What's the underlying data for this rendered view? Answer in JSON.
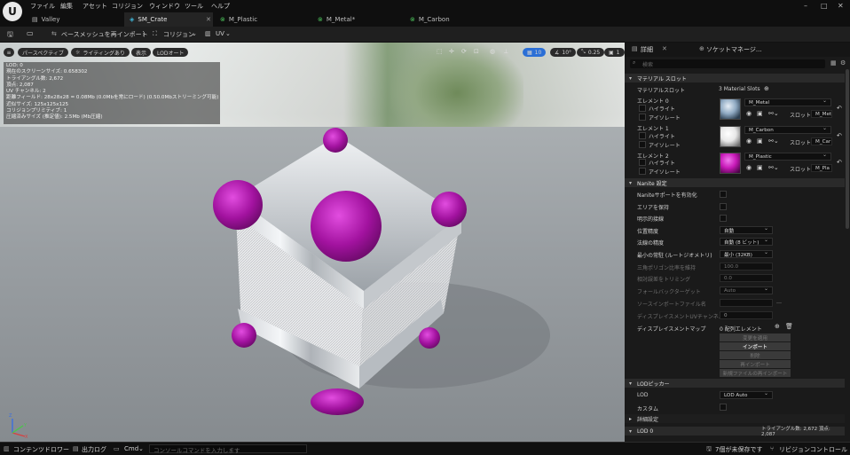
{
  "app": {
    "logo": "U"
  },
  "menu": [
    "ファイル",
    "編集",
    "アセット",
    "コリジョン",
    "ウィンドウ",
    "ツール",
    "ヘルプ"
  ],
  "tabs": [
    {
      "label": "Valley",
      "icon": "level-icon",
      "active": false
    },
    {
      "label": "SM_Crate",
      "icon": "static-mesh-icon",
      "active": true
    },
    {
      "label": "M_Plastic",
      "icon": "material-icon",
      "active": false
    },
    {
      "label": "M_Metal*",
      "icon": "material-icon",
      "active": false
    },
    {
      "label": "M_Carbon",
      "icon": "material-icon",
      "active": false
    }
  ],
  "window_controls": [
    "–",
    "□",
    "✕"
  ],
  "toolbar": {
    "save_icon": "save-icon",
    "browse_icon": "browse-icon",
    "reimport_label": "ベースメッシュを再インポート",
    "collision_label": "コリジョン",
    "uv_label": "UV"
  },
  "viewport": {
    "menu_icon": "≡",
    "perspective": "パースペクティブ",
    "lighting": "ライティングあり",
    "show": "表示",
    "lod": "LODオート",
    "grid_snap": "10",
    "rot_snap": "10°",
    "scale_snap": "0.25",
    "cam_speed": "1",
    "stats": [
      "LOD: 0",
      "現在のスクリーンサイズ: 0.658302",
      "トライアングル数: 2,672",
      "頂点: 2,087",
      "UV チャンネル: 2",
      "距離フィールド: 28x28x28 = 0.08Mb (0.0Mbを常にロード) (0.50.0Mbストリーミング可能)",
      "近似サイズ: 125x125x125",
      "コリジョンプリミティブ: 1",
      "圧縮済みサイズ (推定値): 2.5Mb (Mb圧縮)"
    ],
    "axis": {
      "x": "X",
      "y": "Y",
      "z": "Z"
    }
  },
  "panel": {
    "tabs": [
      "詳細",
      "ソケットマネージ..."
    ],
    "search_placeholder": "検索",
    "material_section": "マテリアル スロット",
    "material_slots_label": "マテリアルスロット",
    "material_slots_value": "3 Material Slots",
    "elements": [
      {
        "label": "エレメント 0",
        "highlight": "ハイライト",
        "isolate": "アイソレート",
        "material": "M_Metal",
        "slot": "スロット名",
        "slot_value": "M_Met",
        "color": "#8fa9c2"
      },
      {
        "label": "エレメント 1",
        "highlight": "ハイライト",
        "isolate": "アイソレート",
        "material": "M_Carbon",
        "slot": "スロット名",
        "slot_value": "M_Car",
        "color": "#e8e8e8"
      },
      {
        "label": "エレメント 2",
        "highlight": "ハイライト",
        "isolate": "アイソレート",
        "material": "M_Plastic",
        "slot": "スロット名",
        "slot_value": "M_Pla",
        "color": "#c81ab8"
      }
    ],
    "nanite_section": "Nanite 設定",
    "nanite_rows": [
      {
        "label": "Naniteサポートを有効化",
        "type": "check",
        "dim": false
      },
      {
        "label": "エリアを保持",
        "type": "check",
        "dim": false
      },
      {
        "label": "明示的接線",
        "type": "check",
        "dim": false
      },
      {
        "label": "位置精度",
        "type": "combo",
        "value": "自動",
        "dim": false
      },
      {
        "label": "法線の精度",
        "type": "combo",
        "value": "自動 (8 ビット)",
        "dim": false
      },
      {
        "label": "最小の常駐 (ルートジオメトリ)",
        "type": "combo",
        "value": "最小 (32KB)",
        "dim": false
      },
      {
        "label": "三角ポリゴン比率を維持",
        "type": "num",
        "value": "100.0",
        "dim": true
      },
      {
        "label": "相対誤差をトリミング",
        "type": "num",
        "value": "0.0",
        "dim": true
      },
      {
        "label": "フォールバックターゲット",
        "type": "combo",
        "value": "Auto",
        "dim": true
      },
      {
        "label": "ソースインポートファイル名",
        "type": "num",
        "value": "",
        "dim": true
      },
      {
        "label": "ディスプレイスメントUVチャンネル",
        "type": "num",
        "value": "0",
        "dim": true
      },
      {
        "label": "ディスプレイスメントマップ",
        "type": "array",
        "value": "0 配列エレメント",
        "dim": false
      }
    ],
    "buttons": [
      {
        "label": "変更を適用",
        "dim": true
      },
      {
        "label": "インポート",
        "dim": false
      },
      {
        "label": "削除",
        "dim": true
      },
      {
        "label": "再インポート",
        "dim": true
      },
      {
        "label": "新規ファイルの再インポート",
        "dim": true
      }
    ],
    "lod_picker_section": "LODピッカー",
    "lod_label": "LOD",
    "lod_value": "LOD Auto",
    "custom_label": "カスタム",
    "detail_section": "詳細設定",
    "lod0_section": "LOD 0",
    "lod0_info": "トライアングル数: 2,672   頂点: 2,087"
  },
  "statusbar": {
    "content_drawer": "コンテンツドロワー",
    "output_log": "出力ログ",
    "cmd": "Cmd",
    "console_placeholder": "コンソールコマンドを入力します",
    "unsaved": "7個が未保存です",
    "revision": "リビジョンコントロール"
  }
}
